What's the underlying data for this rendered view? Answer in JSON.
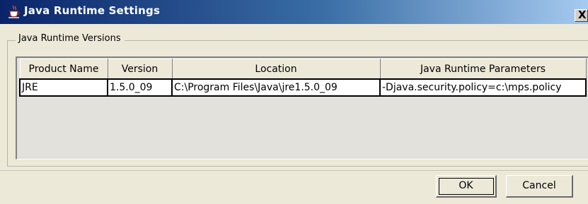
{
  "window": {
    "title": "Java Runtime Settings",
    "close_label": "X",
    "titlebar_colors": [
      "#0a246a",
      "#3a6ea5",
      "#a6caf0"
    ],
    "background": "#ece9d8"
  },
  "group": {
    "label": "Java Runtime Versions"
  },
  "table": {
    "columns": [
      "Product Name",
      "Version",
      "Location",
      "Java Runtime Parameters"
    ],
    "rows": [
      [
        "JRE",
        "1.5.0_09",
        "C:\\Program Files\\Java\\jre1.5.0_09",
        "-Djava.security.policy=c:\\mps.policy"
      ]
    ]
  },
  "buttons": {
    "ok": "OK",
    "cancel": "Cancel"
  },
  "icons": {
    "app": "java-coffee-cup-icon",
    "close": "close-icon"
  }
}
